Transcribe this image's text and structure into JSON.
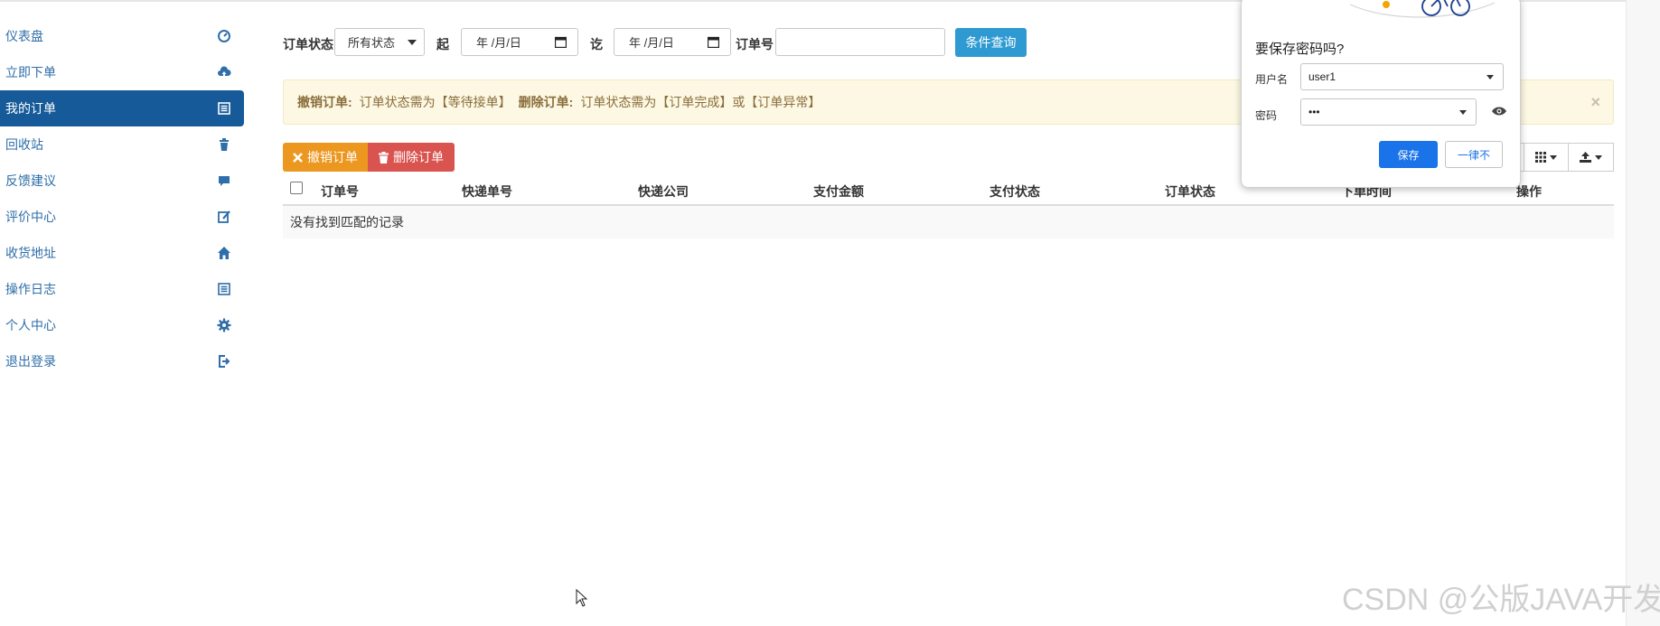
{
  "sidebar": {
    "items": [
      {
        "label": "仪表盘",
        "icon": "dashboard-icon"
      },
      {
        "label": "立即下单",
        "icon": "cloud-upload-icon"
      },
      {
        "label": "我的订单",
        "icon": "list-icon",
        "active": true
      },
      {
        "label": "回收站",
        "icon": "trash-icon"
      },
      {
        "label": "反馈建议",
        "icon": "comment-icon"
      },
      {
        "label": "评价中心",
        "icon": "edit-icon"
      },
      {
        "label": "收货地址",
        "icon": "home-icon"
      },
      {
        "label": "操作日志",
        "icon": "log-icon"
      },
      {
        "label": "个人中心",
        "icon": "gear-icon"
      },
      {
        "label": "退出登录",
        "icon": "logout-icon"
      }
    ]
  },
  "filter": {
    "status_label": "订单状态",
    "status_value": "所有状态",
    "start_label": "起",
    "start_value": "年 /月/日",
    "end_label": "讫",
    "end_value": "年 /月/日",
    "order_no_label": "订单号",
    "order_no_value": "",
    "query_button": "条件查询"
  },
  "alert": {
    "revoke_title": "撤销订单:",
    "revoke_text": "订单状态需为【等待接单】",
    "delete_title": "删除订单:",
    "delete_text": "订单状态需为【订单完成】或【订单异常】",
    "close": "×"
  },
  "toolbar": {
    "revoke_button": "撤销订单",
    "delete_button": "删除订单"
  },
  "table": {
    "columns": [
      "订单号",
      "快递单号",
      "快递公司",
      "支付金额",
      "支付状态",
      "订单状态",
      "下单时间",
      "操作"
    ],
    "empty_text": "没有找到匹配的记录"
  },
  "password_popup": {
    "title": "要保存密码吗?",
    "username_label": "用户名",
    "username_value": "user1",
    "password_label": "密码",
    "password_value": "•••",
    "save_button": "保存",
    "never_button": "一律不"
  },
  "watermark": "CSDN @公版JAVA开发",
  "colors": {
    "sidebar_active": "#165a9a",
    "query_button": "#2f9ad1",
    "revoke_button": "#ec971f",
    "delete_button": "#d9534f",
    "alert_bg": "#fcf8e3",
    "save_button": "#1a73e8"
  }
}
